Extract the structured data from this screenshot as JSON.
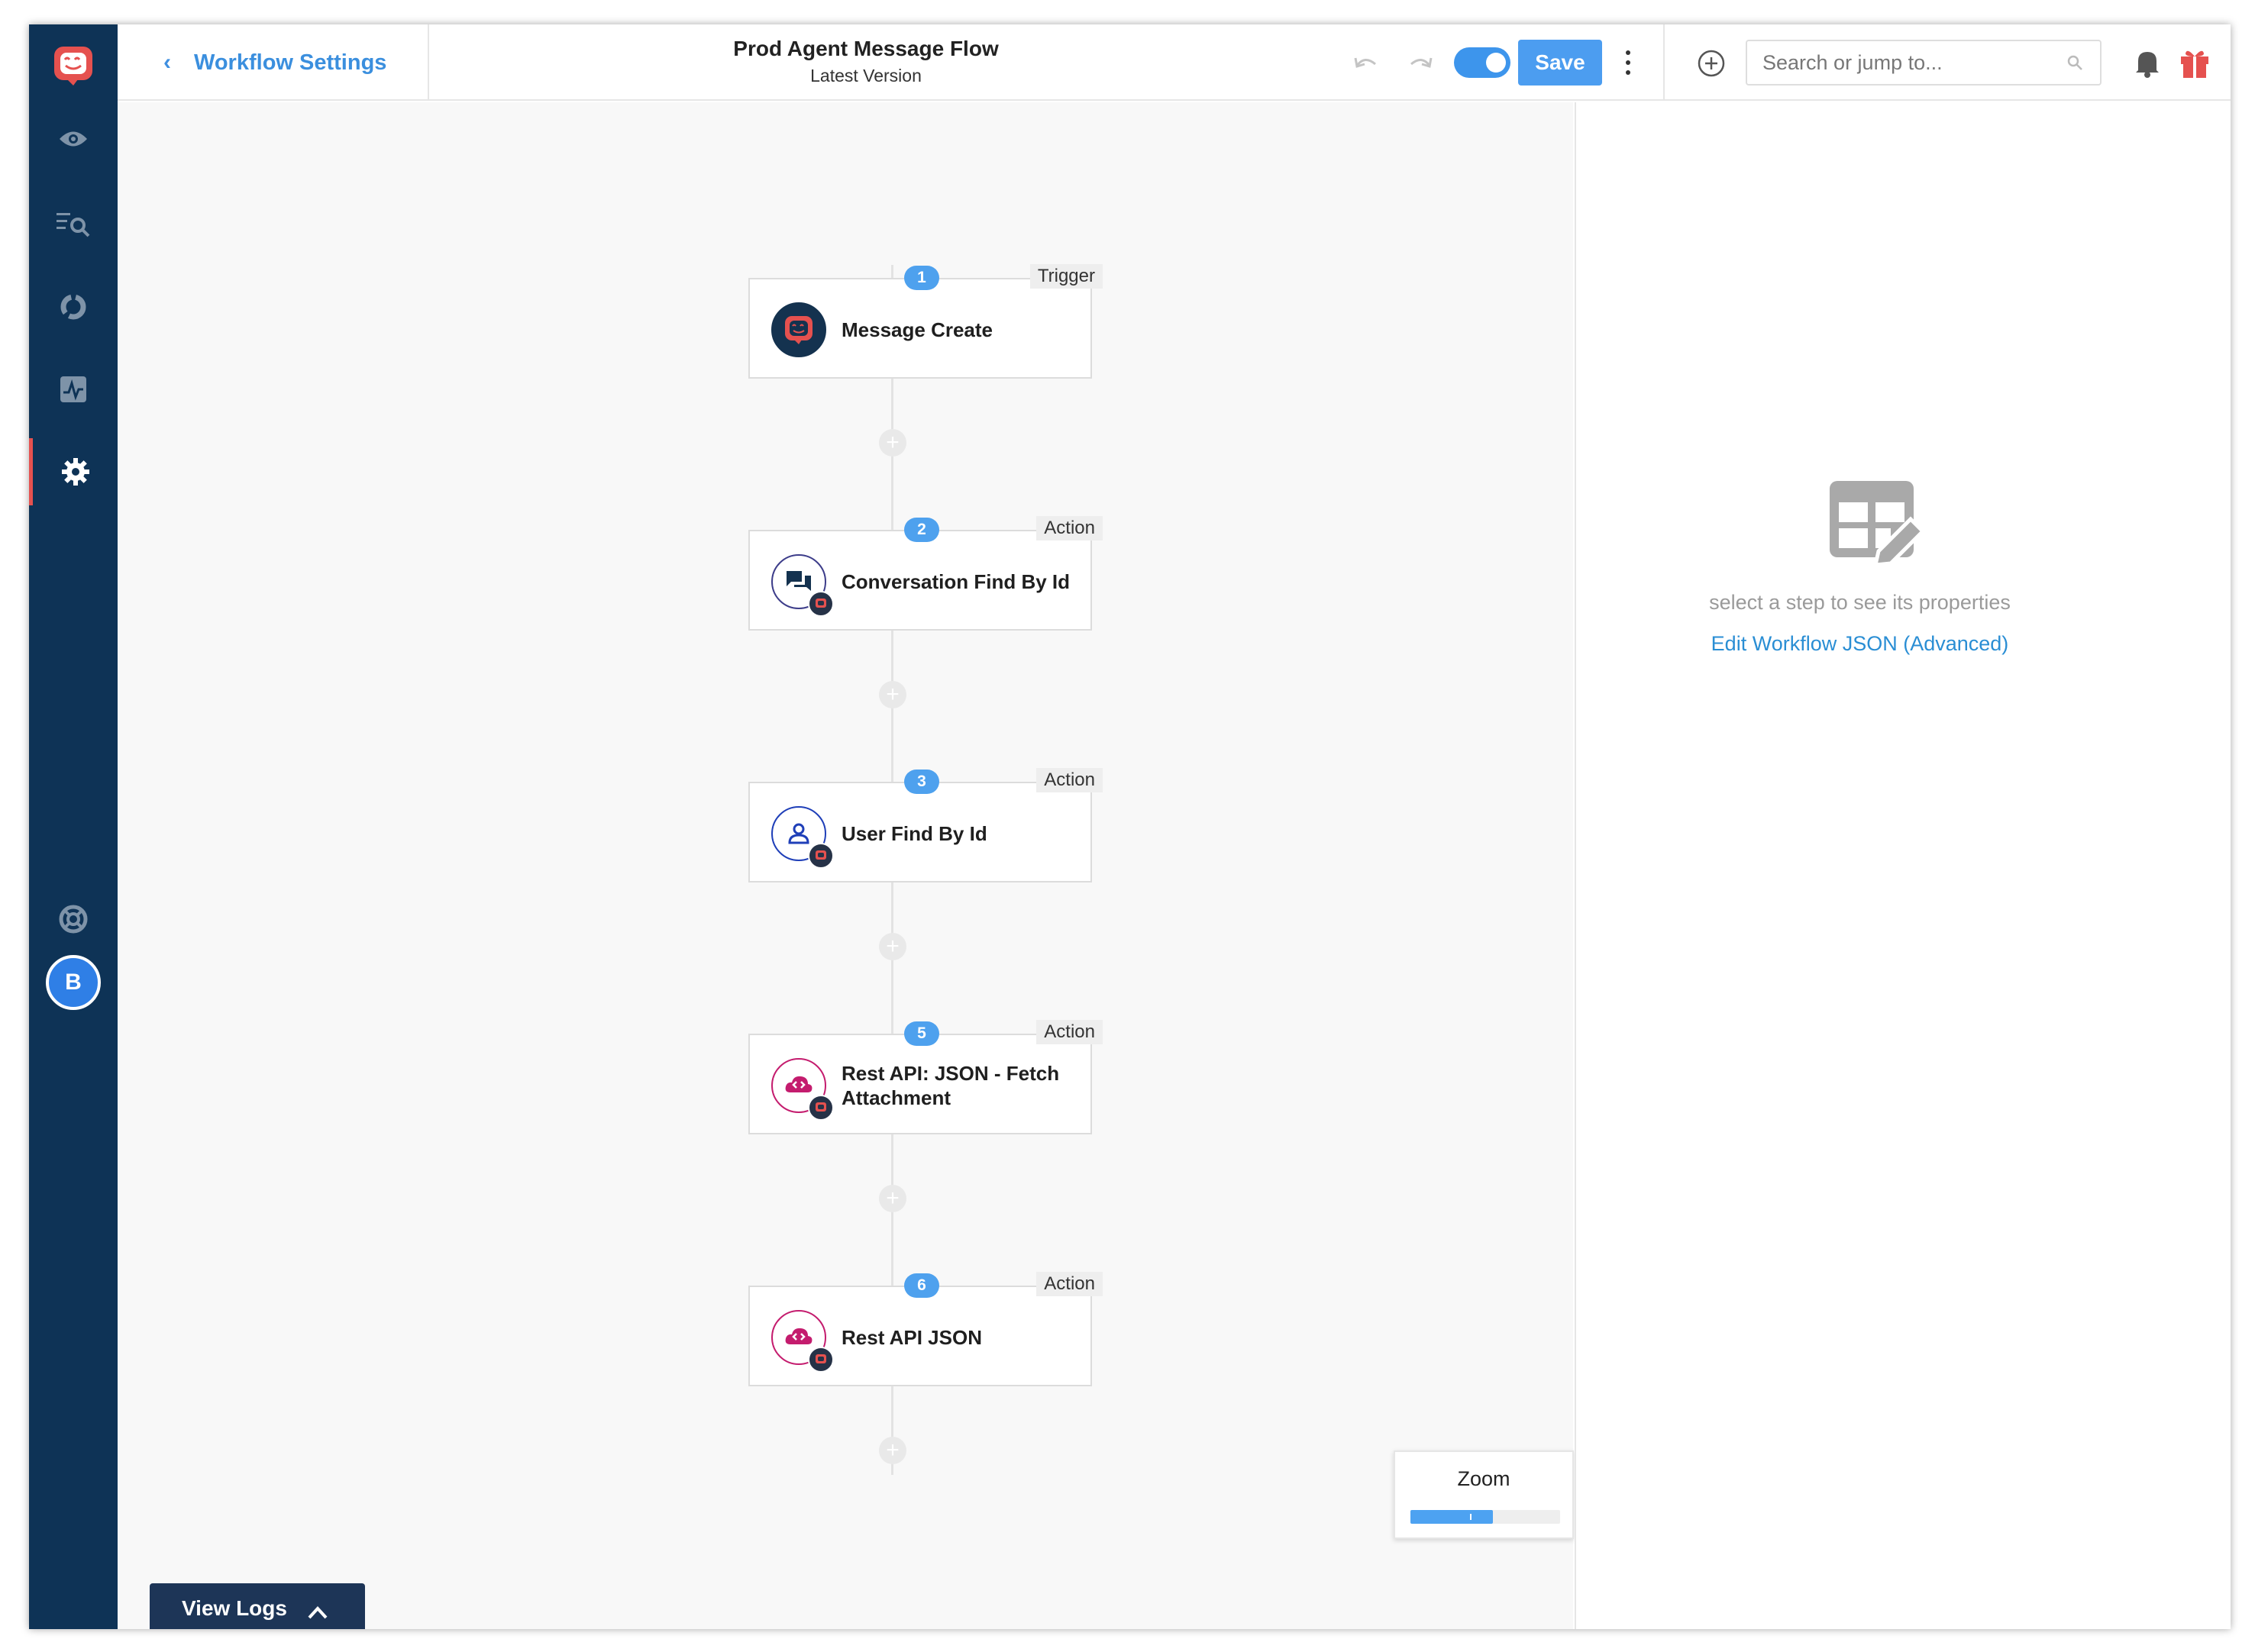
{
  "header": {
    "back_label": "Workflow Settings",
    "title": "Prod Agent Message Flow",
    "subtitle": "Latest Version",
    "save_label": "Save",
    "toggle_on": true
  },
  "search": {
    "placeholder": "Search or jump to..."
  },
  "sidebar": {
    "items": [
      {
        "icon": "eye-icon"
      },
      {
        "icon": "list-search-icon"
      },
      {
        "icon": "chart-ring-icon"
      },
      {
        "icon": "activity-monitor-icon"
      },
      {
        "icon": "gear-icon",
        "active": true
      },
      {
        "icon": "lifebuoy-icon"
      }
    ],
    "avatar_initial": "B"
  },
  "steps": [
    {
      "number": "1",
      "type": "Trigger",
      "name": "Message Create",
      "icon": "app-logo-icon"
    },
    {
      "number": "2",
      "type": "Action",
      "name": "Conversation Find By Id",
      "icon": "chat-icon"
    },
    {
      "number": "3",
      "type": "Action",
      "name": "User Find By Id",
      "icon": "user-icon"
    },
    {
      "number": "5",
      "type": "Action",
      "name": "Rest API: JSON - Fetch Attachment",
      "icon": "cloud-code-icon"
    },
    {
      "number": "6",
      "type": "Action",
      "name": "Rest API JSON",
      "icon": "cloud-code-icon"
    }
  ],
  "zoom": {
    "label": "Zoom",
    "level": 0.55
  },
  "logs": {
    "label": "View Logs"
  },
  "properties": {
    "empty_text": "select a step to see its properties",
    "edit_json_label": "Edit Workflow JSON (Advanced)"
  },
  "colors": {
    "rail": "#0e3356",
    "accent": "#4c9df0",
    "active_marker": "#e5514f"
  }
}
